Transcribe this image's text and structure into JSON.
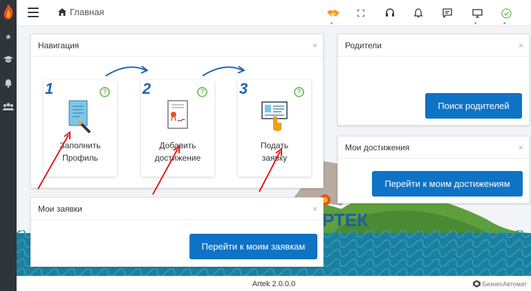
{
  "header": {
    "breadcrumb": "Главная"
  },
  "navigation": {
    "title": "Навигация",
    "steps": [
      {
        "number": "1",
        "line1": "Заполнить",
        "line2": "Профиль"
      },
      {
        "number": "2",
        "line1": "Добавить",
        "line2": "достижение"
      },
      {
        "number": "3",
        "line1": "Подать",
        "line2": "заявку"
      }
    ]
  },
  "parents": {
    "title": "Родители",
    "button": "Поиск родителей"
  },
  "achievements": {
    "title": "Мои достижения",
    "button": "Перейти к моим достижениям"
  },
  "applications": {
    "title": "Мои заявки",
    "button": "Перейти к моим заявкам"
  },
  "background": {
    "logo_text": "РТЕК"
  },
  "footer": {
    "version": "Artek 2.0.0.0",
    "brand": "БизнесАвтомат"
  },
  "colors": {
    "primary": "#0e73c5",
    "sidebar": "#2f353b",
    "accent_orange": "#f29b1d",
    "accent_green": "#7ac36a"
  }
}
